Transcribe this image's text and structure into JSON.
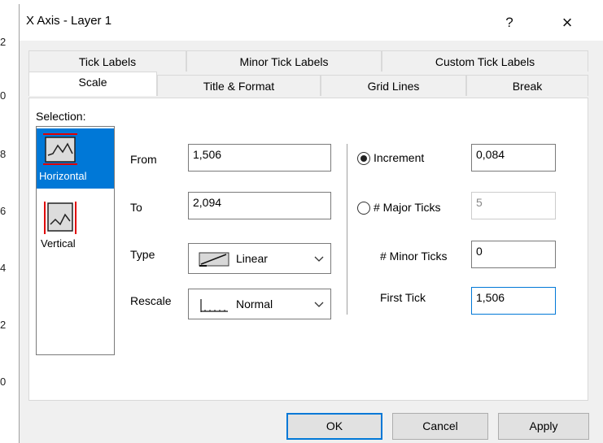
{
  "window": {
    "title": "X Axis - Layer 1",
    "help_label": "?",
    "close_label": "×"
  },
  "background": {
    "axis_digits": [
      "2",
      "0",
      "8",
      "6",
      "4",
      "2",
      "0"
    ]
  },
  "tabs": {
    "row1": [
      "Tick Labels",
      "Minor Tick Labels",
      "Custom Tick Labels"
    ],
    "row2": [
      "Scale",
      "Title & Format",
      "Grid Lines",
      "Break"
    ],
    "active": "Scale"
  },
  "selection": {
    "label": "Selection:",
    "items": [
      {
        "label": "Horizontal",
        "selected": true
      },
      {
        "label": "Vertical",
        "selected": false
      }
    ]
  },
  "from": {
    "label": "From",
    "value": "1,506"
  },
  "to": {
    "label": "To",
    "value": "2,094"
  },
  "type": {
    "label": "Type",
    "value": "Linear"
  },
  "rescale": {
    "label": "Rescale",
    "value": "Normal"
  },
  "increment": {
    "label": "Increment",
    "value": "0,084",
    "selected": true
  },
  "major_ticks": {
    "label": "# Major Ticks",
    "value": "5",
    "selected": false,
    "disabled": true
  },
  "minor_ticks": {
    "label": "# Minor Ticks",
    "value": "0"
  },
  "first_tick": {
    "label": "First Tick",
    "value": "1,506"
  },
  "buttons": {
    "ok": "OK",
    "cancel": "Cancel",
    "apply": "Apply"
  }
}
